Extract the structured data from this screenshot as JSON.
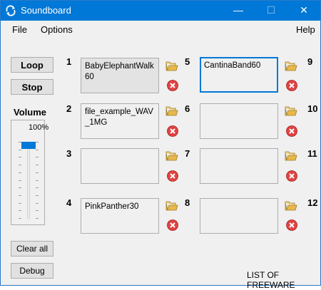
{
  "window": {
    "title": "Soundboard"
  },
  "titlebar_buttons": {
    "minimize": "—",
    "maximize": "☐",
    "close": "✕"
  },
  "menu": {
    "file": "File",
    "options": "Options",
    "help": "Help"
  },
  "buttons": {
    "loop": "Loop",
    "stop": "Stop",
    "clear_all": "Clear all",
    "debug": "Debug"
  },
  "volume": {
    "label": "Volume",
    "percent_label": "100%",
    "level": 1.0
  },
  "slots": [
    {
      "number": "1",
      "text": "BabyElephantWalk60"
    },
    {
      "number": "2",
      "text": "file_example_WAV_1MG"
    },
    {
      "number": "3",
      "text": ""
    },
    {
      "number": "4",
      "text": "PinkPanther30"
    },
    {
      "number": "5",
      "text": "CantinaBand60"
    },
    {
      "number": "6",
      "text": ""
    },
    {
      "number": "7",
      "text": ""
    },
    {
      "number": "8",
      "text": ""
    },
    {
      "number": "9",
      "text": ""
    },
    {
      "number": "10",
      "text": ""
    },
    {
      "number": "11",
      "text": ""
    },
    {
      "number": "12",
      "text": ""
    }
  ],
  "footer": {
    "link": "LIST OF FREEWARE"
  },
  "colors": {
    "accent": "#0078d7",
    "delete": "#e04343",
    "folder": "#e8b84a"
  },
  "icons": {
    "open": "folder-open-icon",
    "delete": "delete-icon"
  }
}
